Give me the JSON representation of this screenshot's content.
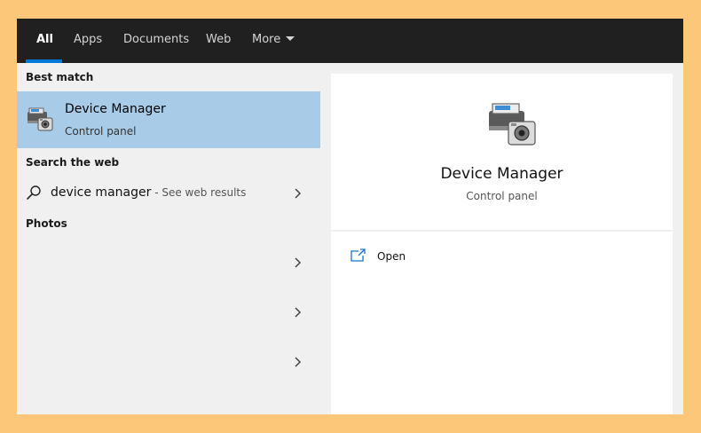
{
  "tabs": [
    {
      "label": "All"
    },
    {
      "label": "Apps"
    },
    {
      "label": "Documents"
    },
    {
      "label": "Web"
    },
    {
      "label": "More"
    }
  ],
  "accent_color": "#0078d7",
  "left": {
    "best_match_label": "Best match",
    "best_match": {
      "title": "Device Manager",
      "subtitle": "Control panel",
      "icon": "device-manager-icon"
    },
    "search_web_label": "Search the web",
    "web_result": {
      "query": "device manager",
      "suffix": " - See web results",
      "icon": "search-icon"
    },
    "photos_label": "Photos"
  },
  "detail": {
    "title": "Device Manager",
    "subtitle": "Control panel",
    "icon": "device-manager-icon",
    "actions": [
      {
        "label": "Open",
        "icon": "open-icon"
      }
    ]
  }
}
